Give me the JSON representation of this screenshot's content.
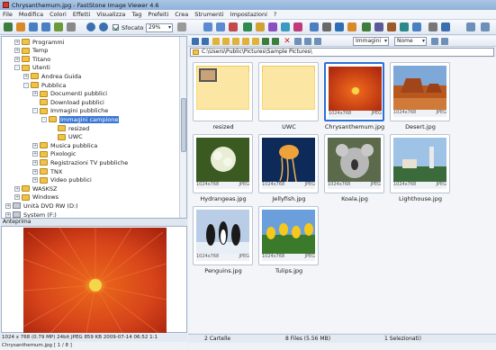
{
  "window": {
    "title": "Chrysanthemum.jpg - FastStone Image Viewer 4.6"
  },
  "menu": [
    "File",
    "Modifica",
    "Colori",
    "Effetti",
    "Visualizza",
    "Tag",
    "Prefeiti",
    "Crea",
    "Strumenti",
    "Impostazioni",
    "?"
  ],
  "toolbar": {
    "blur_label": "Sfocato",
    "blur_checked": true,
    "zoom": "29%"
  },
  "tree": [
    {
      "label": "Programmi",
      "level": 1,
      "toggle": "+",
      "type": "folder"
    },
    {
      "label": "Temp",
      "level": 1,
      "toggle": "+",
      "type": "folder"
    },
    {
      "label": "Titano",
      "level": 1,
      "toggle": "+",
      "type": "folder"
    },
    {
      "label": "Utenti",
      "level": 1,
      "toggle": "-",
      "type": "folder"
    },
    {
      "label": "Andrea Guida",
      "level": 2,
      "toggle": "+",
      "type": "folder"
    },
    {
      "label": "Pubblica",
      "level": 2,
      "toggle": "-",
      "type": "folder"
    },
    {
      "label": "Documenti pubblici",
      "level": 3,
      "toggle": "+",
      "type": "folder"
    },
    {
      "label": "Download pubblici",
      "level": 3,
      "toggle": "",
      "type": "folder"
    },
    {
      "label": "Immagini pubbliche",
      "level": 3,
      "toggle": "-",
      "type": "folder"
    },
    {
      "label": "Immagini campione",
      "level": 4,
      "toggle": "-",
      "type": "folder",
      "selected": true
    },
    {
      "label": "resized",
      "level": 5,
      "toggle": "",
      "type": "folder"
    },
    {
      "label": "UWC",
      "level": 5,
      "toggle": "",
      "type": "folder"
    },
    {
      "label": "Musica pubblica",
      "level": 3,
      "toggle": "+",
      "type": "folder"
    },
    {
      "label": "Pixologic",
      "level": 3,
      "toggle": "+",
      "type": "folder"
    },
    {
      "label": "Registrazioni TV pubbliche",
      "level": 3,
      "toggle": "+",
      "type": "folder"
    },
    {
      "label": "TNX",
      "level": 3,
      "toggle": "+",
      "type": "folder"
    },
    {
      "label": "Video pubblici",
      "level": 3,
      "toggle": "+",
      "type": "folder"
    },
    {
      "label": "WASKSZ",
      "level": 1,
      "toggle": "+",
      "type": "folder"
    },
    {
      "label": "Windows",
      "level": 1,
      "toggle": "+",
      "type": "folder"
    },
    {
      "label": "Unità DVD RW (D:)",
      "level": 0,
      "toggle": "+",
      "type": "drive"
    },
    {
      "label": "System (F:)",
      "level": 0,
      "toggle": "+",
      "type": "drive"
    }
  ],
  "preview_header": "Anteprima",
  "status_left": "1024 x 768 (0.79 MP)  24bit  JPEG   859 KB   2009-07-14 06:52  1:1",
  "status_left2": "Chrysanthemum.jpg [ 1 / 8 ]",
  "nav": {
    "view_combo": "Immagini",
    "sort_combo": "Nome"
  },
  "address": "C:\\Users\\Public\\Pictures\\Sample Pictures\\",
  "thumbs": [
    {
      "name": "resized",
      "kind": "folder",
      "dims": "",
      "fmt": ""
    },
    {
      "name": "UWC",
      "kind": "folder",
      "dims": "",
      "fmt": ""
    },
    {
      "name": "Chrysanthemum.jpg",
      "kind": "chrys",
      "dims": "1024x768",
      "fmt": "JPEG",
      "selected": true
    },
    {
      "name": "Desert.jpg",
      "kind": "desert",
      "dims": "1024x768",
      "fmt": "JPEG"
    },
    {
      "name": "Hydrangeas.jpg",
      "kind": "hydrangea",
      "dims": "1024x768",
      "fmt": "JPEG"
    },
    {
      "name": "Jellyfish.jpg",
      "kind": "jelly",
      "dims": "1024x768",
      "fmt": "JPEG"
    },
    {
      "name": "Koala.jpg",
      "kind": "koala",
      "dims": "1024x768",
      "fmt": "JPEG"
    },
    {
      "name": "Lighthouse.jpg",
      "kind": "lighthouse",
      "dims": "1024x768",
      "fmt": "JPEG"
    },
    {
      "name": "Penguins.jpg",
      "kind": "penguins",
      "dims": "1024x768",
      "fmt": "JPEG"
    },
    {
      "name": "Tulips.jpg",
      "kind": "tulips",
      "dims": "1024x768",
      "fmt": "JPEG"
    }
  ],
  "status_right": {
    "folders": "2 Cartelle",
    "files": "8 Files (5.56 MB)",
    "selected": "1 Selezionati)"
  }
}
